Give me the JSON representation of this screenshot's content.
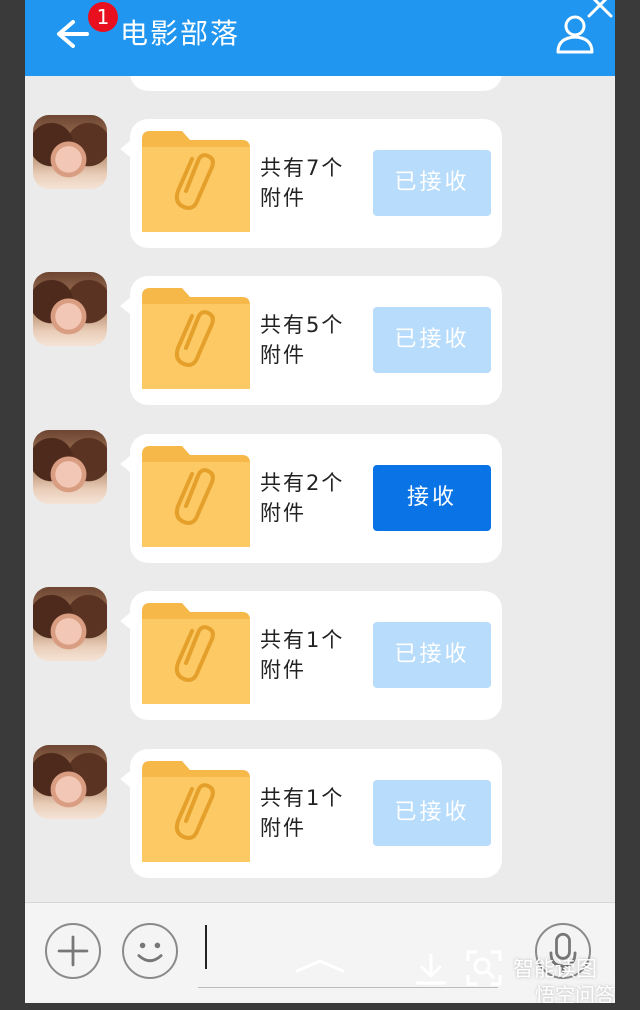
{
  "header": {
    "title": "电影部落",
    "badge_count": "1"
  },
  "messages": [
    {
      "count_text": "共有7个附件",
      "button_label": "已接收",
      "button_state": "received"
    },
    {
      "count_text": "共有5个附件",
      "button_label": "已接收",
      "button_state": "received"
    },
    {
      "count_text": "共有2个附件",
      "button_label": "接收",
      "button_state": "pending"
    },
    {
      "count_text": "共有1个附件",
      "button_label": "已接收",
      "button_state": "received"
    },
    {
      "count_text": "共有1个附件",
      "button_label": "已接收",
      "button_state": "received"
    }
  ],
  "icons": {
    "back": "arrow-left-icon",
    "profile": "person-icon",
    "close": "close-icon",
    "folder": "paperclip-folder-icon",
    "add": "plus-icon",
    "emoji": "smiley-icon",
    "mic": "microphone-icon"
  },
  "colors": {
    "header": "#2196f0",
    "badge": "#e8101e",
    "button_received": "#b8dcfb",
    "button_pending": "#0a74e6",
    "folder": "#fcc964"
  },
  "watermark": {
    "line1": "智能读图",
    "line2": "悟空问答"
  }
}
